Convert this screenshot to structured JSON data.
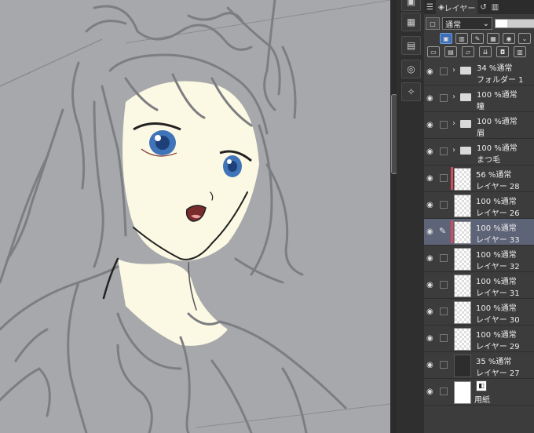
{
  "panel": {
    "tab_label": "レイヤー",
    "blend_mode": "通常",
    "layers": [
      {
        "opacity_mode": "34 %通常",
        "name": "フォルダー 1",
        "kind": "folder",
        "visible": true
      },
      {
        "opacity_mode": "100 %通常",
        "name": "瞳",
        "kind": "folder",
        "visible": true
      },
      {
        "opacity_mode": "100 %通常",
        "name": "眉",
        "kind": "folder",
        "visible": true
      },
      {
        "opacity_mode": "100 %通常",
        "name": "まつ毛",
        "kind": "folder",
        "visible": true
      },
      {
        "opacity_mode": "56 %通常",
        "name": "レイヤー 28",
        "kind": "raster",
        "visible": true,
        "clip": true
      },
      {
        "opacity_mode": "100 %通常",
        "name": "レイヤー 26",
        "kind": "raster",
        "visible": true
      },
      {
        "opacity_mode": "100 %通常",
        "name": "レイヤー 33",
        "kind": "raster",
        "visible": true,
        "selected": true,
        "clip": true
      },
      {
        "opacity_mode": "100 %通常",
        "name": "レイヤー 32",
        "kind": "raster",
        "visible": true
      },
      {
        "opacity_mode": "100 %通常",
        "name": "レイヤー 31",
        "kind": "raster",
        "visible": true
      },
      {
        "opacity_mode": "100 %通常",
        "name": "レイヤー 30",
        "kind": "raster",
        "visible": true
      },
      {
        "opacity_mode": "100 %通常",
        "name": "レイヤー 29",
        "kind": "raster",
        "visible": true
      },
      {
        "opacity_mode": "35 %通常",
        "name": "レイヤー 27",
        "kind": "dark",
        "visible": true
      },
      {
        "opacity_mode": "",
        "name": "用紙",
        "kind": "paper",
        "visible": true
      }
    ]
  },
  "colors": {
    "canvas_bg": "#a7a8ab",
    "skin": "#fbf8e3",
    "eye_blue": "#3f74b8",
    "selected_row": "#5e6477",
    "clip_mark": "#d9495e"
  }
}
